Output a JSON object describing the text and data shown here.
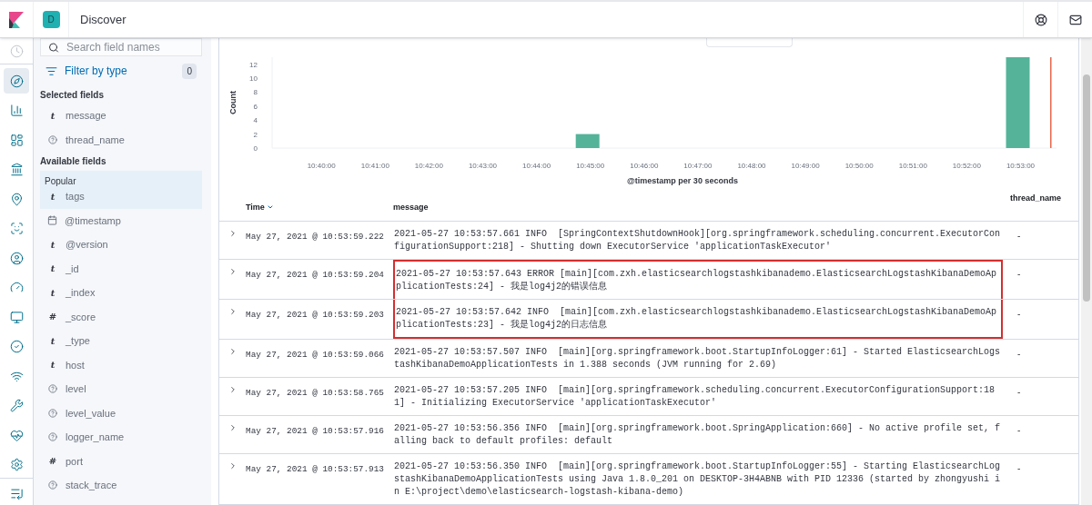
{
  "header": {
    "space_badge": "D",
    "title": "Discover"
  },
  "nav": {
    "top": [
      {
        "kind": "clock",
        "selected": false
      }
    ],
    "items": [
      {
        "kind": "compass",
        "selected": true
      },
      {
        "kind": "chart",
        "selected": false
      },
      {
        "kind": "dashboard",
        "selected": false
      },
      {
        "kind": "canvas",
        "selected": false
      },
      {
        "kind": "map",
        "selected": false
      },
      {
        "kind": "ml",
        "selected": false
      },
      {
        "kind": "user",
        "selected": false
      },
      {
        "kind": "apm",
        "selected": false
      },
      {
        "kind": "monitor",
        "selected": false
      },
      {
        "kind": "uptime",
        "selected": false
      },
      {
        "kind": "signal",
        "selected": false
      },
      {
        "kind": "wrench",
        "selected": false
      },
      {
        "kind": "heart",
        "selected": false
      },
      {
        "kind": "gear",
        "selected": false
      }
    ],
    "bottom": [
      {
        "kind": "collapse",
        "selected": false
      }
    ]
  },
  "field_sidebar": {
    "search": {
      "placeholder": "Search field names"
    },
    "filter": {
      "label": "Filter by type",
      "count": "0"
    },
    "selected_heading": "Selected fields",
    "selected_fields": [
      {
        "name": "message",
        "kind": "string",
        "glyph": "t"
      },
      {
        "name": "thread_name",
        "kind": "unknown"
      }
    ],
    "available_heading": "Available fields",
    "popular": {
      "label": "Popular",
      "fields": [
        {
          "name": "tags",
          "kind": "string",
          "glyph": "t"
        }
      ]
    },
    "available_fields": [
      {
        "name": "@timestamp",
        "kind": "date"
      },
      {
        "name": "@version",
        "kind": "string",
        "glyph": "t"
      },
      {
        "name": "_id",
        "kind": "string",
        "glyph": "t"
      },
      {
        "name": "_index",
        "kind": "string",
        "glyph": "t"
      },
      {
        "name": "_score",
        "kind": "number",
        "glyph": "#"
      },
      {
        "name": "_type",
        "kind": "string",
        "glyph": "t"
      },
      {
        "name": "host",
        "kind": "string",
        "glyph": "t"
      },
      {
        "name": "level",
        "kind": "unknown"
      },
      {
        "name": "level_value",
        "kind": "unknown"
      },
      {
        "name": "logger_name",
        "kind": "unknown"
      },
      {
        "name": "port",
        "kind": "number",
        "glyph": "#"
      },
      {
        "name": "stack_trace",
        "kind": "unknown"
      }
    ]
  },
  "chart": {
    "chart_data": {
      "type": "bar",
      "xlabel": "@timestamp per 30 seconds",
      "ylabel": "Count",
      "categories": [
        "10:40:00",
        "10:41:00",
        "10:42:00",
        "10:43:00",
        "10:44:00",
        "10:45:00",
        "10:46:00",
        "10:47:00",
        "10:48:00",
        "10:49:00",
        "10:50:00",
        "10:51:00",
        "10:52:00",
        "10:53:00"
      ],
      "values": [
        0,
        0,
        0,
        0,
        0,
        2,
        0,
        0,
        0,
        0,
        0,
        0,
        0,
        13
      ],
      "ylim": [
        0,
        13
      ],
      "yticks": [
        0,
        2,
        4,
        6,
        8,
        10,
        12
      ]
    }
  },
  "table": {
    "columns": [
      "Time",
      "message",
      "thread_name"
    ],
    "rows": [
      {
        "time": "May 27, 2021 @ 10:53:59.222",
        "message": "2021-05-27 10:53:57.661 INFO  [SpringContextShutdownHook][org.springframework.scheduling.concurrent.ExecutorConfigurationSupport:218] - Shutting down ExecutorService 'applicationTaskExecutor'",
        "thread_name": "-",
        "highlighted": false
      },
      {
        "time": "May 27, 2021 @ 10:53:59.204",
        "message": "2021-05-27 10:53:57.643 ERROR [main][com.zxh.elasticsearchlogstashkibanademo.ElasticsearchLogstashKibanaDemoApplicationTests:24] - 我是log4j2的错误信息",
        "thread_name": "-",
        "highlighted": true
      },
      {
        "time": "May 27, 2021 @ 10:53:59.203",
        "message": "2021-05-27 10:53:57.642 INFO  [main][com.zxh.elasticsearchlogstashkibanademo.ElasticsearchLogstashKibanaDemoApplicationTests:23] - 我是log4j2的日志信息",
        "thread_name": "-",
        "highlighted": true
      },
      {
        "time": "May 27, 2021 @ 10:53:59.066",
        "message": "2021-05-27 10:53:57.507 INFO  [main][org.springframework.boot.StartupInfoLogger:61] - Started ElasticsearchLogstashKibanaDemoApplicationTests in 1.388 seconds (JVM running for 2.69)",
        "thread_name": "-",
        "highlighted": false
      },
      {
        "time": "May 27, 2021 @ 10:53:58.765",
        "message": "2021-05-27 10:53:57.205 INFO  [main][org.springframework.scheduling.concurrent.ExecutorConfigurationSupport:181] - Initializing ExecutorService 'applicationTaskExecutor'",
        "thread_name": "-",
        "highlighted": false
      },
      {
        "time": "May 27, 2021 @ 10:53:57.916",
        "message": "2021-05-27 10:53:56.356 INFO  [main][org.springframework.boot.SpringApplication:660] - No active profile set, falling back to default profiles: default",
        "thread_name": "-",
        "highlighted": false
      },
      {
        "time": "May 27, 2021 @ 10:53:57.913",
        "message": "2021-05-27 10:53:56.350 INFO  [main][org.springframework.boot.StartupInfoLogger:55] - Starting ElasticsearchLogstashKibanaDemoApplicationTests using Java 1.8.0_201 on DESKTOP-3H4ABNB with PID 12336 (started by zhongyushi in E:\\project\\demo\\elasticsearch-logstash-kibana-demo)",
        "thread_name": "-",
        "highlighted": false
      }
    ]
  }
}
